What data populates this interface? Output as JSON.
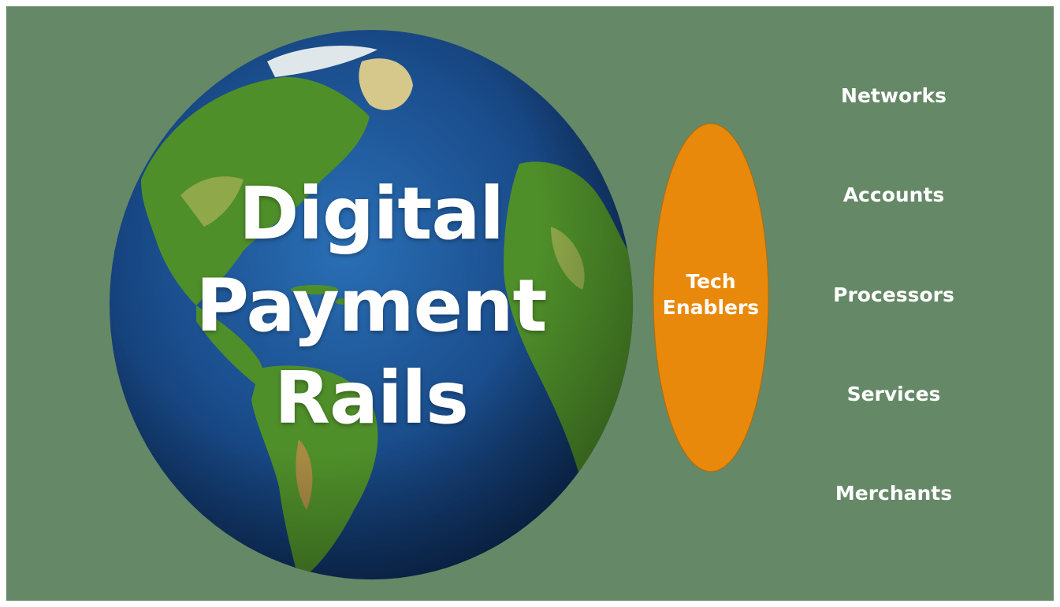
{
  "title": {
    "lines": [
      "Digital",
      "Payment",
      "Rails"
    ]
  },
  "oval": {
    "lines": [
      "Tech",
      "Enablers"
    ],
    "color": "#e8890c"
  },
  "categories": [
    "Networks",
    "Accounts",
    "Processors",
    "Services",
    "Merchants"
  ],
  "colors": {
    "background": "#658866",
    "ocean": "#1a4d8c",
    "land": "#4f8f2a",
    "text": "#ffffff"
  }
}
